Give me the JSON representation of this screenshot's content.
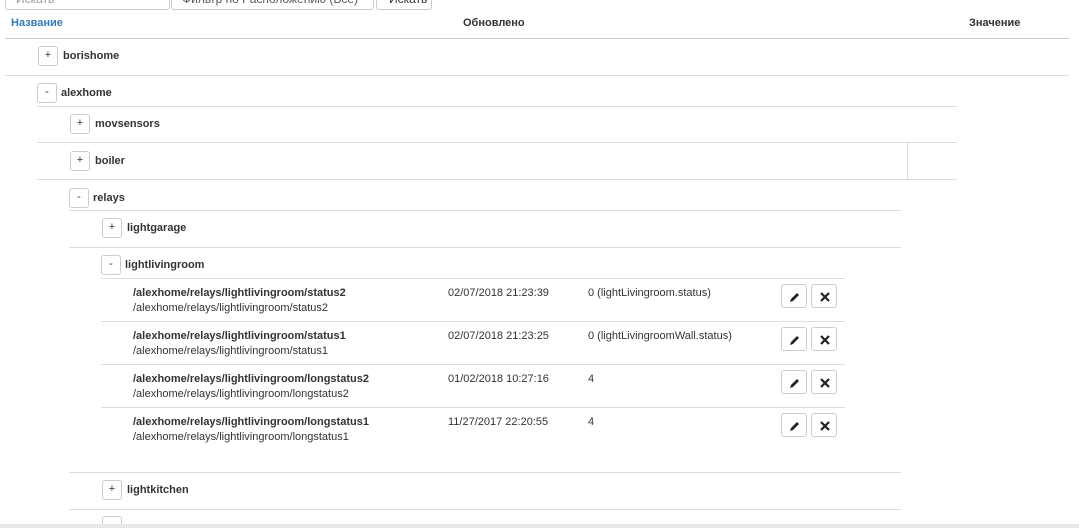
{
  "filters": {
    "search_placeholder": "Искать",
    "location_placeholder": "Фильтр по Расположению (Все)",
    "search_button": "Искать"
  },
  "columns": {
    "name": "Название",
    "updated": "Обновлено",
    "value": "Значение"
  },
  "tree": {
    "borishome": {
      "toggle": "+",
      "label": "borishome"
    },
    "alexhome": {
      "toggle": "-",
      "label": "alexhome"
    },
    "movsensors": {
      "toggle": "+",
      "label": "movsensors"
    },
    "boiler": {
      "toggle": "+",
      "label": "boiler"
    },
    "relays": {
      "toggle": "-",
      "label": "relays"
    },
    "lightgarage": {
      "toggle": "+",
      "label": "lightgarage"
    },
    "lightlivingroom": {
      "toggle": "-",
      "label": "lightlivingroom"
    },
    "lightkitchen": {
      "toggle": "+",
      "label": "lightkitchen"
    },
    "next_toggle": "+"
  },
  "rows": [
    {
      "path_bold": "/alexhome/relays/lightlivingroom/status2",
      "path": "/alexhome/relays/lightlivingroom/status2",
      "updated": "02/07/2018 21:23:39",
      "value": "0 (lightLivingroom.status)"
    },
    {
      "path_bold": "/alexhome/relays/lightlivingroom/status1",
      "path": "/alexhome/relays/lightlivingroom/status1",
      "updated": "02/07/2018 21:23:25",
      "value": "0 (lightLivingroomWall.status)"
    },
    {
      "path_bold": "/alexhome/relays/lightlivingroom/longstatus2",
      "path": "/alexhome/relays/lightlivingroom/longstatus2",
      "updated": "01/02/2018 10:27:16",
      "value": "4"
    },
    {
      "path_bold": "/alexhome/relays/lightlivingroom/longstatus1",
      "path": "/alexhome/relays/lightlivingroom/longstatus1",
      "updated": "11/27/2017 22:20:55",
      "value": "4"
    }
  ],
  "icons": {
    "edit": "pencil-icon",
    "delete": "x-icon"
  },
  "colors": {
    "header_link": "#337ab7",
    "border": "#dddddd",
    "text": "#333333"
  }
}
